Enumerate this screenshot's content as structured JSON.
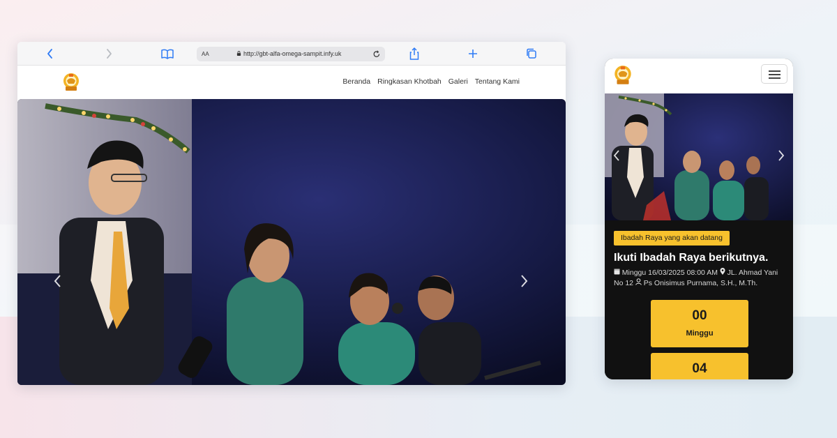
{
  "browser": {
    "url": "http://gbt-alfa-omega-sampit.infy.uk",
    "url_aa": "AA",
    "icons": [
      "back-icon",
      "forward-icon",
      "bookmarks-icon",
      "share-icon",
      "new-tab-icon",
      "tabs-icon",
      "reload-icon",
      "lock-icon"
    ]
  },
  "site": {
    "nav": [
      "Beranda",
      "Ringkasan Khotbah",
      "Galeri",
      "Tentang Kami"
    ]
  },
  "mobile": {
    "badge": "Ibadah Raya yang akan datang",
    "title": "Ikuti Ibadah Raya berikutnya.",
    "date": "Minggu 16/03/2025 08:00 AM",
    "location": "JL. Ahmad Yani No 12",
    "pastor": "Ps Onisimus Purnama, S.H., M.Th.",
    "countdown": [
      {
        "value": "00",
        "label": "Minggu"
      },
      {
        "value": "04",
        "label": ""
      }
    ]
  },
  "colors": {
    "accent": "#f7c12d",
    "ios_blue": "#2f7bf5",
    "dark_bg": "#111111"
  }
}
